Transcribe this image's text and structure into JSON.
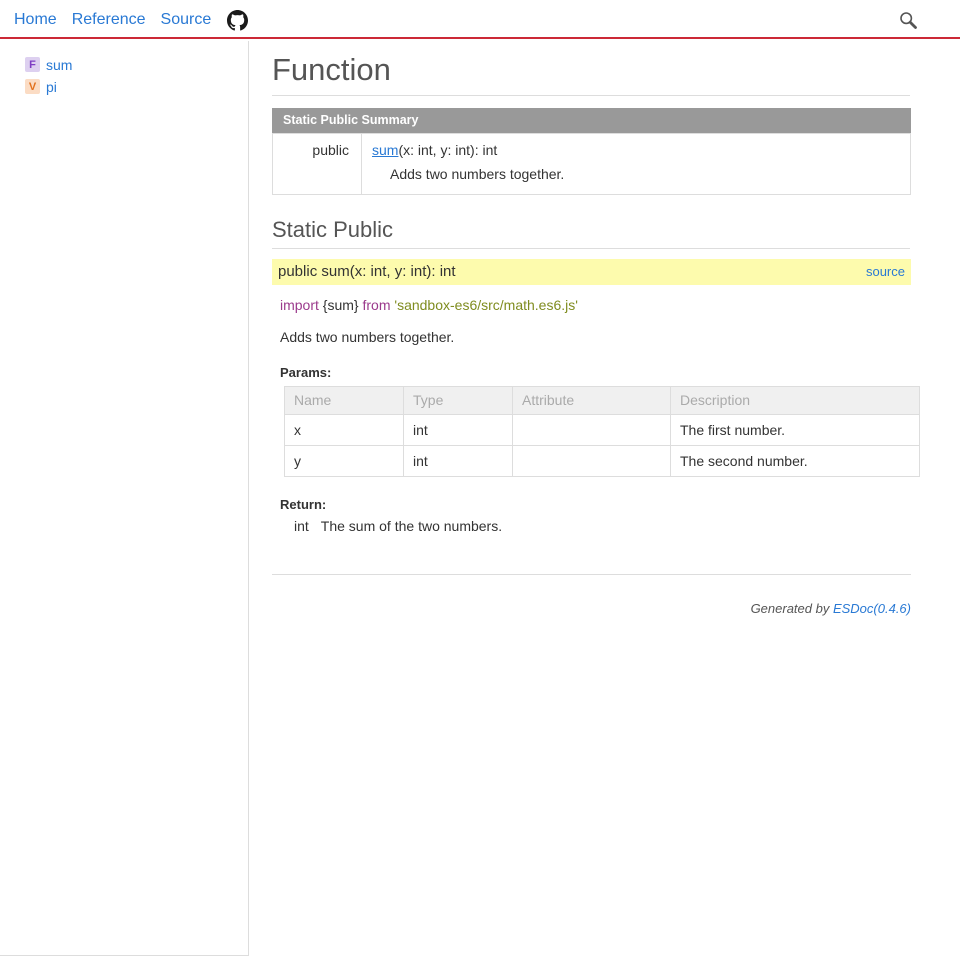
{
  "header": {
    "nav": [
      {
        "label": "Home"
      },
      {
        "label": "Reference"
      },
      {
        "label": "Source"
      }
    ],
    "github_icon": "github-icon",
    "search_icon": "search-icon"
  },
  "sidebar": {
    "items": [
      {
        "kind": "F",
        "label": "sum"
      },
      {
        "kind": "V",
        "label": "pi"
      }
    ]
  },
  "main": {
    "page_title": "Function",
    "summary": {
      "caption": "Static Public Summary",
      "rows": [
        {
          "access": "public",
          "name": "sum",
          "signature": "(x: int, y: int): int",
          "description": "Adds two numbers together."
        }
      ]
    },
    "section_title": "Static Public",
    "detail": {
      "signature": "public sum(x: int, y: int): int",
      "source_label": "source",
      "import": {
        "keyword_import": "import",
        "binding": " {sum} ",
        "keyword_from": "from",
        "path": " 'sandbox-es6/src/math.es6.js'"
      },
      "description": "Adds two numbers together.",
      "params_label": "Params:",
      "params_columns": [
        "Name",
        "Type",
        "Attribute",
        "Description"
      ],
      "params_rows": [
        {
          "name": "x",
          "type": "int",
          "attribute": "",
          "description": "The first number."
        },
        {
          "name": "y",
          "type": "int",
          "attribute": "",
          "description": "The second number."
        }
      ],
      "return_label": "Return:",
      "return_type": "int",
      "return_description": "The sum of the two numbers."
    }
  },
  "footer": {
    "generated_by": "Generated by ",
    "tool": "ESDoc(0.4.6)"
  },
  "colors": {
    "accent_red": "#cc2936",
    "link_blue": "#2979d4",
    "highlight_yellow": "#fdfbad",
    "summary_header_gray": "#999999",
    "kind_function": "#7e3ec3",
    "kind_variable": "#e2711d"
  }
}
